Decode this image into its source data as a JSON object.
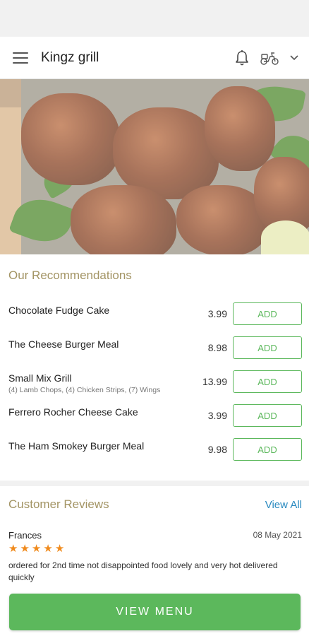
{
  "app": {
    "title": "Kingz grill"
  },
  "header": {
    "menu_icon": "hamburger-icon",
    "notification_icon": "bell-icon",
    "delivery_icon": "scooter-icon",
    "dropdown_icon": "chevron-down-icon"
  },
  "hero": {
    "image": "grilled-chicken-photo"
  },
  "recommendations": {
    "title": "Our Recommendations",
    "add_label": "ADD",
    "items": [
      {
        "name": "Chocolate Fudge Cake",
        "description": "",
        "price": "3.99"
      },
      {
        "name": "The Cheese Burger Meal",
        "description": "",
        "price": "8.98"
      },
      {
        "name": "Small Mix Grill",
        "description": "(4) Lamb Chops, (4) Chicken Strips, (7) Wings",
        "price": "13.99"
      },
      {
        "name": "Ferrero Rocher Cheese Cake",
        "description": "",
        "price": "3.99"
      },
      {
        "name": "The Ham Smokey Burger Meal",
        "description": "",
        "price": "9.98"
      }
    ]
  },
  "reviews": {
    "title": "Customer Reviews",
    "view_all_label": "View All",
    "items": [
      {
        "author": "Frances",
        "date": "08 May 2021",
        "rating": 5,
        "text": "ordered for 2nd time not disappointed food lovely and very hot delivered quickly"
      }
    ]
  },
  "footer": {
    "view_menu_label": "VIEW MENU"
  },
  "colors": {
    "accent_green": "#5cb85c",
    "section_title": "#a39464",
    "link_blue": "#2a8ac0",
    "star": "#f08a1c"
  }
}
